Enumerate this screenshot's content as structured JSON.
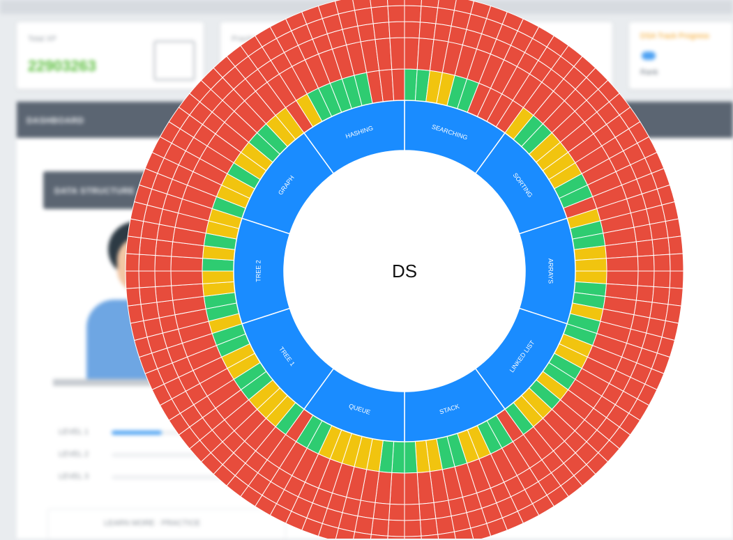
{
  "chart_data": {
    "type": "sunburst",
    "center_label": "DS",
    "topics": [
      "SEARCHING",
      "SORTING",
      "ARRAYS",
      "LINKED LIST",
      "STACK",
      "QUEUE",
      "TREE 1",
      "TREE 2",
      "GRAPH",
      "HASHING"
    ],
    "ring_count": 5,
    "slices_per_topic": 10,
    "status_colors": {
      "solved": "#2ecc71",
      "attempted": "#f1c40f",
      "unsolved": "#e74c3c"
    },
    "topic_color": "#1a8cff",
    "topic_text_color": "#ffffff",
    "inner_ring_status": [
      [
        "solved",
        "solved",
        "attempted",
        "attempted",
        "solved",
        "solved",
        "unsolved",
        "unsolved",
        "unsolved",
        "unsolved"
      ],
      [
        "attempted",
        "solved",
        "solved",
        "attempted",
        "attempted",
        "attempted",
        "attempted",
        "solved",
        "solved",
        "unsolved"
      ],
      [
        "attempted",
        "solved",
        "solved",
        "attempted",
        "attempted",
        "attempted",
        "solved",
        "solved",
        "attempted",
        "solved"
      ],
      [
        "solved",
        "attempted",
        "attempted",
        "solved",
        "solved",
        "attempted",
        "solved",
        "attempted",
        "attempted",
        "solved"
      ],
      [
        "unsolved",
        "solved",
        "solved",
        "attempted",
        "attempted",
        "solved",
        "solved",
        "attempted",
        "attempted",
        "solved"
      ],
      [
        "solved",
        "solved",
        "attempted",
        "attempted",
        "attempted",
        "attempted",
        "attempted",
        "solved",
        "solved",
        "unsolved"
      ],
      [
        "solved",
        "attempted",
        "attempted",
        "attempted",
        "solved",
        "solved",
        "attempted",
        "attempted",
        "solved",
        "solved"
      ],
      [
        "attempted",
        "solved",
        "solved",
        "attempted",
        "attempted",
        "solved",
        "attempted",
        "solved",
        "attempted",
        "attempted"
      ],
      [
        "solved",
        "attempted",
        "attempted",
        "solved",
        "attempted",
        "attempted",
        "solved",
        "solved",
        "attempted",
        "attempted"
      ],
      [
        "unsolved",
        "attempted",
        "solved",
        "solved",
        "solved",
        "solved",
        "solved",
        "unsolved",
        "unsolved",
        "unsolved"
      ]
    ],
    "outer_rings_status": "unsolved"
  },
  "background": {
    "dashboard_label": "DASHBOARD",
    "panel_title": "DATA STRUCTURE",
    "stat_value": "22903263",
    "stat_label": "Total XP",
    "card2_label": "Practice",
    "card3_label": "DSA Track Progress",
    "card3_sub": "Rank",
    "level_rows": [
      "LEVEL 1",
      "LEVEL 2",
      "LEVEL 3"
    ],
    "level_fill": [
      0.45,
      0.0,
      0.0
    ],
    "footer_link": "LEARN MORE · PRACTICE"
  }
}
